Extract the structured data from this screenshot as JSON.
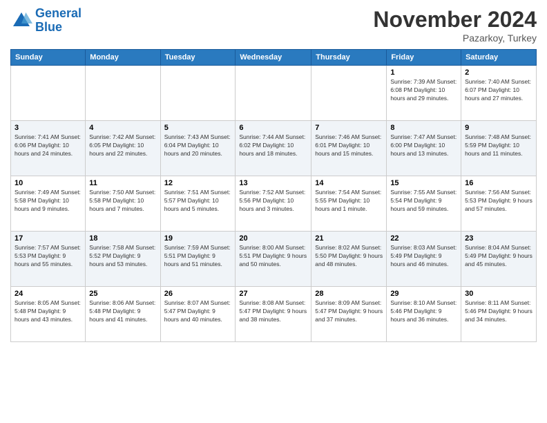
{
  "logo": {
    "line1": "General",
    "line2": "Blue"
  },
  "title": "November 2024",
  "subtitle": "Pazarkoy, Turkey",
  "days_of_week": [
    "Sunday",
    "Monday",
    "Tuesday",
    "Wednesday",
    "Thursday",
    "Friday",
    "Saturday"
  ],
  "weeks": [
    [
      {
        "day": "",
        "info": ""
      },
      {
        "day": "",
        "info": ""
      },
      {
        "day": "",
        "info": ""
      },
      {
        "day": "",
        "info": ""
      },
      {
        "day": "",
        "info": ""
      },
      {
        "day": "1",
        "info": "Sunrise: 7:39 AM\nSunset: 6:08 PM\nDaylight: 10 hours and 29 minutes."
      },
      {
        "day": "2",
        "info": "Sunrise: 7:40 AM\nSunset: 6:07 PM\nDaylight: 10 hours and 27 minutes."
      }
    ],
    [
      {
        "day": "3",
        "info": "Sunrise: 7:41 AM\nSunset: 6:06 PM\nDaylight: 10 hours and 24 minutes."
      },
      {
        "day": "4",
        "info": "Sunrise: 7:42 AM\nSunset: 6:05 PM\nDaylight: 10 hours and 22 minutes."
      },
      {
        "day": "5",
        "info": "Sunrise: 7:43 AM\nSunset: 6:04 PM\nDaylight: 10 hours and 20 minutes."
      },
      {
        "day": "6",
        "info": "Sunrise: 7:44 AM\nSunset: 6:02 PM\nDaylight: 10 hours and 18 minutes."
      },
      {
        "day": "7",
        "info": "Sunrise: 7:46 AM\nSunset: 6:01 PM\nDaylight: 10 hours and 15 minutes."
      },
      {
        "day": "8",
        "info": "Sunrise: 7:47 AM\nSunset: 6:00 PM\nDaylight: 10 hours and 13 minutes."
      },
      {
        "day": "9",
        "info": "Sunrise: 7:48 AM\nSunset: 5:59 PM\nDaylight: 10 hours and 11 minutes."
      }
    ],
    [
      {
        "day": "10",
        "info": "Sunrise: 7:49 AM\nSunset: 5:58 PM\nDaylight: 10 hours and 9 minutes."
      },
      {
        "day": "11",
        "info": "Sunrise: 7:50 AM\nSunset: 5:58 PM\nDaylight: 10 hours and 7 minutes."
      },
      {
        "day": "12",
        "info": "Sunrise: 7:51 AM\nSunset: 5:57 PM\nDaylight: 10 hours and 5 minutes."
      },
      {
        "day": "13",
        "info": "Sunrise: 7:52 AM\nSunset: 5:56 PM\nDaylight: 10 hours and 3 minutes."
      },
      {
        "day": "14",
        "info": "Sunrise: 7:54 AM\nSunset: 5:55 PM\nDaylight: 10 hours and 1 minute."
      },
      {
        "day": "15",
        "info": "Sunrise: 7:55 AM\nSunset: 5:54 PM\nDaylight: 9 hours and 59 minutes."
      },
      {
        "day": "16",
        "info": "Sunrise: 7:56 AM\nSunset: 5:53 PM\nDaylight: 9 hours and 57 minutes."
      }
    ],
    [
      {
        "day": "17",
        "info": "Sunrise: 7:57 AM\nSunset: 5:53 PM\nDaylight: 9 hours and 55 minutes."
      },
      {
        "day": "18",
        "info": "Sunrise: 7:58 AM\nSunset: 5:52 PM\nDaylight: 9 hours and 53 minutes."
      },
      {
        "day": "19",
        "info": "Sunrise: 7:59 AM\nSunset: 5:51 PM\nDaylight: 9 hours and 51 minutes."
      },
      {
        "day": "20",
        "info": "Sunrise: 8:00 AM\nSunset: 5:51 PM\nDaylight: 9 hours and 50 minutes."
      },
      {
        "day": "21",
        "info": "Sunrise: 8:02 AM\nSunset: 5:50 PM\nDaylight: 9 hours and 48 minutes."
      },
      {
        "day": "22",
        "info": "Sunrise: 8:03 AM\nSunset: 5:49 PM\nDaylight: 9 hours and 46 minutes."
      },
      {
        "day": "23",
        "info": "Sunrise: 8:04 AM\nSunset: 5:49 PM\nDaylight: 9 hours and 45 minutes."
      }
    ],
    [
      {
        "day": "24",
        "info": "Sunrise: 8:05 AM\nSunset: 5:48 PM\nDaylight: 9 hours and 43 minutes."
      },
      {
        "day": "25",
        "info": "Sunrise: 8:06 AM\nSunset: 5:48 PM\nDaylight: 9 hours and 41 minutes."
      },
      {
        "day": "26",
        "info": "Sunrise: 8:07 AM\nSunset: 5:47 PM\nDaylight: 9 hours and 40 minutes."
      },
      {
        "day": "27",
        "info": "Sunrise: 8:08 AM\nSunset: 5:47 PM\nDaylight: 9 hours and 38 minutes."
      },
      {
        "day": "28",
        "info": "Sunrise: 8:09 AM\nSunset: 5:47 PM\nDaylight: 9 hours and 37 minutes."
      },
      {
        "day": "29",
        "info": "Sunrise: 8:10 AM\nSunset: 5:46 PM\nDaylight: 9 hours and 36 minutes."
      },
      {
        "day": "30",
        "info": "Sunrise: 8:11 AM\nSunset: 5:46 PM\nDaylight: 9 hours and 34 minutes."
      }
    ]
  ]
}
